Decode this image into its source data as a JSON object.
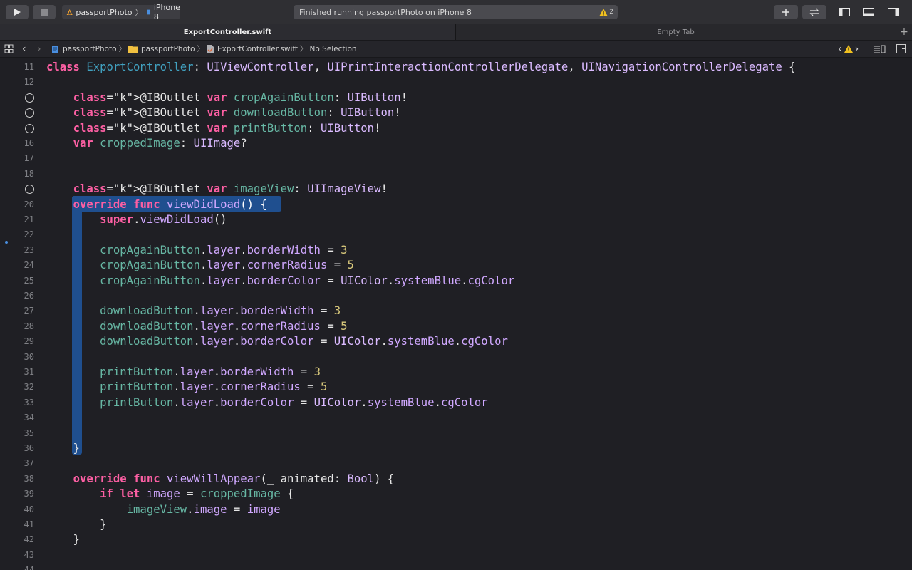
{
  "toolbar": {
    "scheme_name": "passportPhoto",
    "device": "iPhone 8",
    "status": "Finished running passportPhoto on iPhone 8",
    "warning_count": "2"
  },
  "tabs": [
    {
      "label": "ExportController.swift",
      "active": true
    },
    {
      "label": "Empty Tab",
      "active": false
    }
  ],
  "breadcrumb": [
    "passportPhoto",
    "passportPhoto",
    "ExportController.swift",
    "No Selection"
  ],
  "code_lines": [
    {
      "num": "11",
      "text": "class ExportController: UIViewController, UIPrintInteractionControllerDelegate, UINavigationControllerDelegate {"
    },
    {
      "num": "12",
      "text": ""
    },
    {
      "num": "13",
      "text": "    @IBOutlet var cropAgainButton: UIButton!"
    },
    {
      "num": "14",
      "text": "    @IBOutlet var downloadButton: UIButton!"
    },
    {
      "num": "15",
      "text": "    @IBOutlet var printButton: UIButton!"
    },
    {
      "num": "16",
      "text": "    var croppedImage: UIImage?"
    },
    {
      "num": "17",
      "text": ""
    },
    {
      "num": "18",
      "text": ""
    },
    {
      "num": "19",
      "text": "    @IBOutlet var imageView: UIImageView!"
    },
    {
      "num": "20",
      "text": "    override func viewDidLoad() {"
    },
    {
      "num": "21",
      "text": "        super.viewDidLoad()"
    },
    {
      "num": "22",
      "text": ""
    },
    {
      "num": "23",
      "text": "        cropAgainButton.layer.borderWidth = 3"
    },
    {
      "num": "24",
      "text": "        cropAgainButton.layer.cornerRadius = 5"
    },
    {
      "num": "25",
      "text": "        cropAgainButton.layer.borderColor = UIColor.systemBlue.cgColor"
    },
    {
      "num": "26",
      "text": ""
    },
    {
      "num": "27",
      "text": "        downloadButton.layer.borderWidth = 3"
    },
    {
      "num": "28",
      "text": "        downloadButton.layer.cornerRadius = 5"
    },
    {
      "num": "29",
      "text": "        downloadButton.layer.borderColor = UIColor.systemBlue.cgColor"
    },
    {
      "num": "30",
      "text": ""
    },
    {
      "num": "31",
      "text": "        printButton.layer.borderWidth = 3"
    },
    {
      "num": "32",
      "text": "        printButton.layer.cornerRadius = 5"
    },
    {
      "num": "33",
      "text": "        printButton.layer.borderColor = UIColor.systemBlue.cgColor"
    },
    {
      "num": "34",
      "text": ""
    },
    {
      "num": "35",
      "text": ""
    },
    {
      "num": "36",
      "text": "    }"
    },
    {
      "num": "37",
      "text": ""
    },
    {
      "num": "38",
      "text": "    override func viewWillAppear(_ animated: Bool) {"
    },
    {
      "num": "39",
      "text": "        if let image = croppedImage {"
    },
    {
      "num": "40",
      "text": "            imageView.image = image"
    },
    {
      "num": "41",
      "text": "        }"
    },
    {
      "num": "42",
      "text": "    }"
    },
    {
      "num": "43",
      "text": ""
    },
    {
      "num": "44",
      "text": ""
    }
  ]
}
